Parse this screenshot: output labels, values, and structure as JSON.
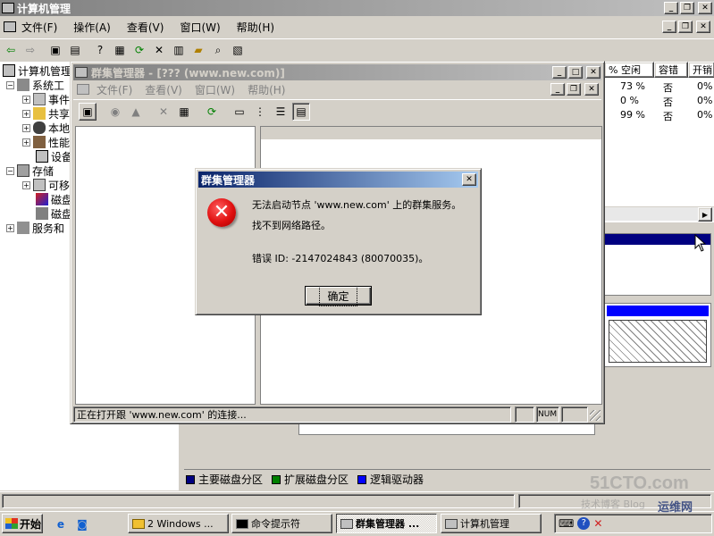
{
  "main_window": {
    "title": "计算机管理",
    "menu": [
      "文件(F)",
      "操作(A)",
      "查看(V)",
      "窗口(W)",
      "帮助(H)"
    ],
    "tree_root": "计算机管理",
    "tree": [
      {
        "label": "系统工",
        "expander": "−"
      },
      {
        "label": "事件",
        "expander": "+"
      },
      {
        "label": "共享",
        "expander": "+"
      },
      {
        "label": "本地",
        "expander": "+"
      },
      {
        "label": "性能",
        "expander": "+"
      },
      {
        "label": "设备",
        "expander": ""
      },
      {
        "label": "存储",
        "expander": "−"
      },
      {
        "label": "可移",
        "expander": "+"
      },
      {
        "label": "磁盘",
        "expander": ""
      },
      {
        "label": "磁盘",
        "expander": ""
      },
      {
        "label": "服务和",
        "expander": "+"
      }
    ],
    "columns": [
      "% 空闲",
      "容错",
      "开销"
    ],
    "rows": [
      {
        "free": "73 %",
        "fault": "否",
        "overhead": "0%"
      },
      {
        "free": "0 %",
        "fault": "否",
        "overhead": "0%"
      },
      {
        "free": "99 %",
        "fault": "否",
        "overhead": "0%"
      }
    ],
    "legend": [
      {
        "label": "主要磁盘分区",
        "color": "#000080"
      },
      {
        "label": "扩展磁盘分区",
        "color": "#008000"
      },
      {
        "label": "逻辑驱动器",
        "color": "#0000ff"
      }
    ]
  },
  "cluster_window": {
    "title": "群集管理器 - [??? (www.new.com)]",
    "menu": [
      "文件(F)",
      "查看(V)",
      "窗口(W)",
      "帮助(H)"
    ],
    "status_text": "正在打开跟 'www.new.com' 的连接...",
    "status_num": "NUM"
  },
  "dialog": {
    "title": "群集管理器",
    "line1": "无法启动节点 'www.new.com' 上的群集服务。",
    "line2": "找不到网络路径。",
    "line3": "错误 ID: -2147024843 (80070035)。",
    "ok_label": "确定"
  },
  "taskbar": {
    "start_label": "开始",
    "tasks": [
      "2 Windows ...",
      "命令提示符",
      "群集管理器 ...",
      "计算机管理"
    ],
    "watermark1": "51CTO.com",
    "watermark2": "运维网",
    "watermark3": "技术博客 Blog"
  },
  "colors": {
    "title_active": "#0a246a",
    "title_active_end": "#a6caf0",
    "title_inactive": "#808080",
    "desktop_face": "#d4d0c8",
    "error_red": "#e01010"
  },
  "icons": [
    "back-icon",
    "forward-icon",
    "error-icon",
    "computer-icon",
    "cursor-icon"
  ]
}
